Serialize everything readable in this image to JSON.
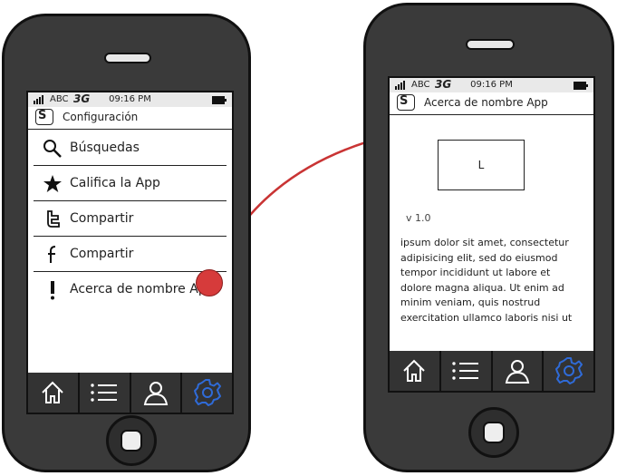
{
  "statusbar": {
    "carrier": "ABC",
    "network": "3G",
    "time": "09:16 PM"
  },
  "screen1": {
    "title": "Configuración",
    "items": [
      {
        "label": "Búsquedas",
        "icon": "search-icon"
      },
      {
        "label": "Califica la App",
        "icon": "star-icon"
      },
      {
        "label": "Compartir",
        "icon": "twitter-icon"
      },
      {
        "label": "Compartir",
        "icon": "facebook-icon"
      },
      {
        "label": "Acerca de nombre App",
        "icon": "exclamation-icon"
      }
    ]
  },
  "screen2": {
    "title": "Acerca de nombre App",
    "logo_text": "L",
    "version": "v 1.0",
    "about_text": "ipsum dolor sit amet, consectetur adipisicing elit, sed do eiusmod tempor incididunt ut labore et dolore magna aliqua. Ut enim ad minim veniam, quis nostrud exercitation ullamco laboris nisi ut"
  },
  "tabbar": [
    "home-icon",
    "list-icon",
    "user-icon",
    "gear-icon"
  ],
  "colors": {
    "accent": "#2f6bd8",
    "arrow": "#c93434",
    "phone": "#3a3a3a",
    "tabbar": "#333333"
  }
}
